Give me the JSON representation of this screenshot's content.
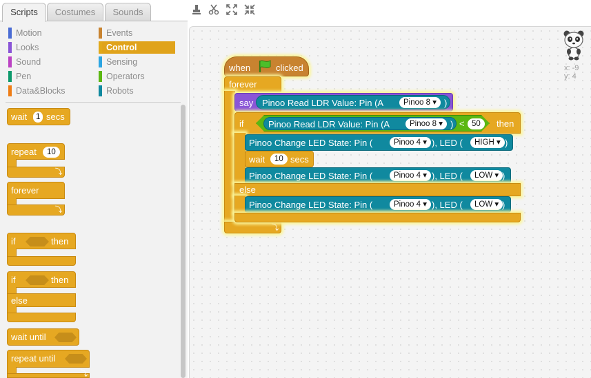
{
  "tabs": [
    {
      "label": "Scripts",
      "active": true
    },
    {
      "label": "Costumes",
      "active": false
    },
    {
      "label": "Sounds",
      "active": false
    }
  ],
  "toolbar_icons": [
    "stamp-icon",
    "scissors-icon",
    "grow-icon",
    "shrink-icon"
  ],
  "categories": {
    "left": [
      {
        "label": "Motion",
        "color": "#4a6cd4"
      },
      {
        "label": "Looks",
        "color": "#8a55d7"
      },
      {
        "label": "Sound",
        "color": "#bb42c3"
      },
      {
        "label": "Pen",
        "color": "#0e9a6c"
      },
      {
        "label": "Data&Blocks",
        "color": "#ee7d16"
      }
    ],
    "right": [
      {
        "label": "Events",
        "color": "#c88330"
      },
      {
        "label": "Control",
        "color": "#e1a91a",
        "selected": true
      },
      {
        "label": "Sensing",
        "color": "#2ca5e2"
      },
      {
        "label": "Operators",
        "color": "#5cb712"
      },
      {
        "label": "Robots",
        "color": "#10899f"
      }
    ]
  },
  "palette": {
    "wait": {
      "label": "wait",
      "value": "1",
      "unit": "secs"
    },
    "repeat": {
      "label": "repeat",
      "value": "10"
    },
    "forever": {
      "label": "forever"
    },
    "if_then": {
      "if": "if",
      "then": "then"
    },
    "if_else": {
      "if": "if",
      "then": "then",
      "else": "else"
    },
    "wait_until": {
      "label": "wait until"
    },
    "repeat_until": {
      "label": "repeat until"
    }
  },
  "script": {
    "hat": {
      "when": "when",
      "clicked": "clicked"
    },
    "forever": "forever",
    "say": {
      "label": "say",
      "reporter": "Pinoo Read LDR Value: Pin (A",
      "pin": "Pinoo 8",
      "close": ")"
    },
    "if": {
      "if": "if",
      "reporter": "Pinoo Read LDR Value: Pin (A",
      "pin": "Pinoo 8",
      "close": ")",
      "op": "<",
      "value": "50",
      "then": "then"
    },
    "led_high": {
      "label": "Pinoo Change LED State: Pin (",
      "pin": "Pinoo 4",
      "mid": "), LED (",
      "state": "HIGH",
      "close": ")"
    },
    "wait": {
      "label": "wait",
      "value": "10",
      "unit": "secs"
    },
    "led_low1": {
      "label": "Pinoo Change LED State: Pin (",
      "pin": "Pinoo 4",
      "mid": "), LED (",
      "state": "LOW",
      "close": ")"
    },
    "else": "else",
    "led_low2": {
      "label": "Pinoo Change LED State: Pin (",
      "pin": "Pinoo 4",
      "mid": "), LED (",
      "state": "LOW",
      "close": ")"
    }
  },
  "sprite": {
    "x_label": "x:",
    "x": "-9",
    "y_label": "y:",
    "y": "4"
  }
}
